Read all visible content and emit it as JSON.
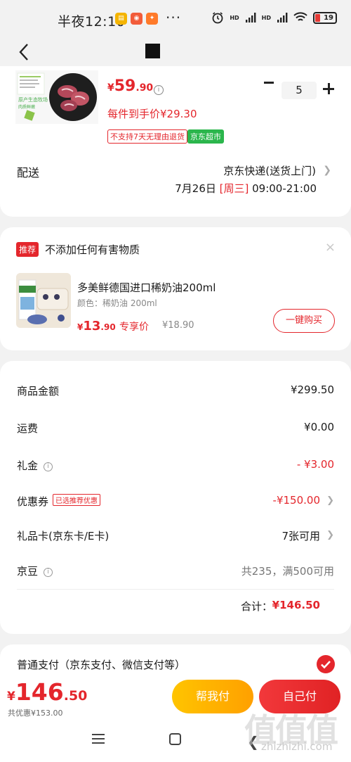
{
  "status_bar": {
    "time": "半夜12:10",
    "dots": "···",
    "hd1": "HD",
    "hd2": "HD",
    "battery": "19"
  },
  "product": {
    "price_currency": "¥",
    "price_int": "59",
    "price_dec": ".90",
    "quantity": "5",
    "unit_price": "每件到手价¥29.30",
    "tag_noreturn": "不支持7天无理由退货",
    "tag_store": "京东超市",
    "img_text_1": "原产生态牧场",
    "img_text_2": "肉质鲜嫩",
    "delivery_label": "配送",
    "delivery_method": "京东快递(送货上门)",
    "delivery_date_prefix": "7月26日 ",
    "delivery_weekday": "[周三]",
    "delivery_time": " 09:00-21:00"
  },
  "recommendation": {
    "badge": "推荐",
    "title": "不添加任何有害物质",
    "close": "×",
    "name": "多美鲜德国进口稀奶油200ml",
    "spec": "颜色：稀奶油 200ml",
    "price_currency": "¥",
    "price_int": "13",
    "price_dec": ".90",
    "exclusive_label": "专享价",
    "original_price": "¥18.90",
    "buy_label": "一键购买"
  },
  "summary": {
    "goods_label": "商品金额",
    "goods_value": "¥299.50",
    "shipping_label": "运费",
    "shipping_value": "¥0.00",
    "gift_label": "礼金",
    "gift_value": "- ¥3.00",
    "coupon_label": "优惠券",
    "coupon_tag": "已选推荐优惠",
    "coupon_value": "-¥150.00",
    "giftcard_label": "礼品卡(京东卡/E卡)",
    "giftcard_value": "7张可用",
    "jingdou_label": "京豆",
    "jingdou_value": "共235，满500可用",
    "total_label": "合计：",
    "total_value": "¥146.50"
  },
  "payment": {
    "label": "普通支付（京东支付、微信支付等）"
  },
  "bottom": {
    "price_currency": "¥",
    "price_int": "146",
    "price_dec": ".50",
    "discount": "共优惠¥153.00",
    "help_pay": "帮我付",
    "self_pay": "自己付"
  },
  "watermark": {
    "text": "值值值",
    "url": "zhizhizhi.com"
  },
  "colors": {
    "accent_red": "#e4262c",
    "store_green": "#2bb64c",
    "help_yellow": "#ffb300"
  },
  "icons": [
    "back-icon",
    "info-icon",
    "minus-icon",
    "plus-icon",
    "chevron-right-icon",
    "close-icon",
    "check-icon",
    "menu-icon",
    "home-icon",
    "back-nav-icon"
  ]
}
